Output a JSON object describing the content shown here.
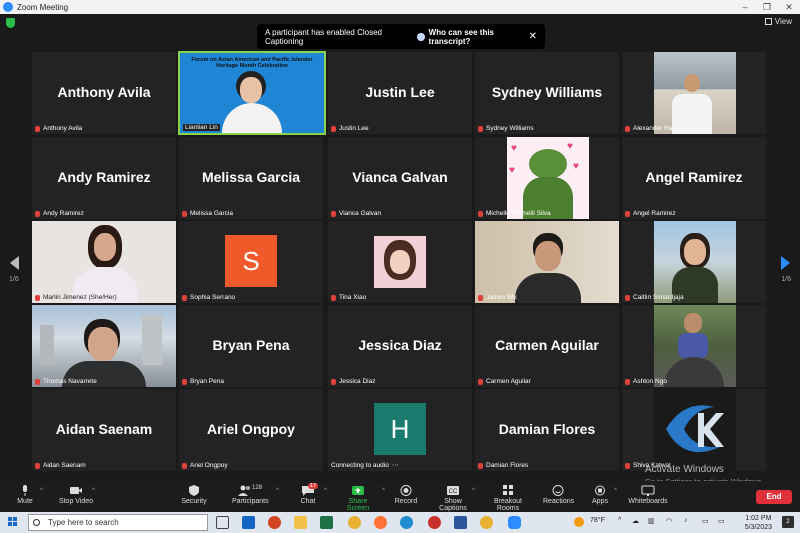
{
  "window": {
    "title": "Zoom Meeting",
    "minimize": "–",
    "maximize": "❐",
    "close": "✕"
  },
  "header": {
    "view_label": "View"
  },
  "banner": {
    "message": "A participant has enabled Closed Captioning",
    "who_label": "Who can see this transcript?",
    "close": "✕"
  },
  "pager": {
    "left": "1/6",
    "right": "1/6"
  },
  "participants": [
    {
      "big": "Anthony Avila",
      "label": "Anthony Avila",
      "muted": true
    },
    {
      "label": "Lianlian Lin",
      "slide_text": "Forum on Asian American and Pacific Islander Heritage Month Celebration",
      "muted": false,
      "active": true
    },
    {
      "big": "Justin Lee",
      "label": "Justin Lee",
      "muted": true
    },
    {
      "big": "Sydney Williams",
      "label": "Sydney Williams",
      "muted": true
    },
    {
      "label": "Alexander Ha",
      "muted": true
    },
    {
      "big": "Andy Ramirez",
      "label": "Andy Ramirez",
      "muted": true
    },
    {
      "big": "Melissa Garcia",
      "label": "Melissa Garcia",
      "muted": true
    },
    {
      "big": "Vianca Galvan",
      "label": "Vianca Galvan",
      "muted": true
    },
    {
      "label": "Michelle Fremelli Silva",
      "muted": true
    },
    {
      "big": "Angel Ramirez",
      "label": "Angel Ramirez",
      "muted": true
    },
    {
      "label": "Marlin Jimenez (She/Her)",
      "muted": true
    },
    {
      "label": "Sophia Serrano",
      "letter": "S",
      "letter_color": "#f0592a",
      "muted": true
    },
    {
      "label": "Tina Xiao",
      "muted": true
    },
    {
      "label": "James Wu",
      "muted": true
    },
    {
      "label": "Caitlin Simardjaja",
      "muted": true
    },
    {
      "label": "Thomas Navarrete",
      "muted": true
    },
    {
      "big": "Bryan Pena",
      "label": "Bryan Pena",
      "muted": true
    },
    {
      "big": "Jessica Diaz",
      "label": "Jessica Diaz",
      "muted": true
    },
    {
      "big": "Carmen Aguilar",
      "label": "Carmen Aguilar",
      "muted": true
    },
    {
      "label": "Ashton Ngo",
      "muted": true
    },
    {
      "big": "Aidan Saenam",
      "label": "Aidan Saenam",
      "muted": true
    },
    {
      "big": "Ariel Ongpoy",
      "label": "Ariel Ongpoy",
      "muted": true
    },
    {
      "label": "Connecting to audio",
      "letter": "H",
      "letter_color": "#1a7a6e",
      "muted": false
    },
    {
      "big": "Damian Flores",
      "label": "Damian Flores",
      "muted": true
    },
    {
      "label": "Shiva Katwal",
      "muted": true
    }
  ],
  "watermark": {
    "line1": "Activate Windows",
    "line2": "Go to Settings to activate Windows."
  },
  "toolbar": {
    "mute": "Mute",
    "stop_video": "Stop Video",
    "security": "Security",
    "participants": "Participants",
    "participants_count": "128",
    "chat": "Chat",
    "chat_badge": "17",
    "share_screen": "Share Screen",
    "record": "Record",
    "captions": "Show Captions",
    "breakout": "Breakout Rooms",
    "reactions": "Reactions",
    "apps": "Apps",
    "whiteboards": "Whiteboards",
    "end": "End",
    "cc": "CC"
  },
  "taskbar": {
    "search_placeholder": "Type here to search",
    "temp": "78°F",
    "time": "1:02 PM",
    "date": "5/3/2023",
    "notif_count": "2"
  },
  "colors": {
    "accent": "#2d8cff",
    "active_border": "#8bd34a",
    "end": "#e0303c"
  }
}
